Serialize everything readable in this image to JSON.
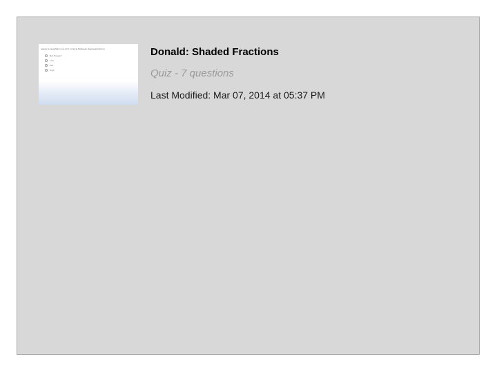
{
  "item": {
    "title": "Donald: Shaded Fractions",
    "subtitle": "Quiz - 7 questions",
    "last_modified": "Last Modified: Mar 07, 2014 at 05:37 PM"
  },
  "thumbnail": {
    "question": "Assign a weighted score for Linking Between Representations",
    "options": [
      "Not Present",
      "Low",
      "Mid",
      "High"
    ]
  }
}
